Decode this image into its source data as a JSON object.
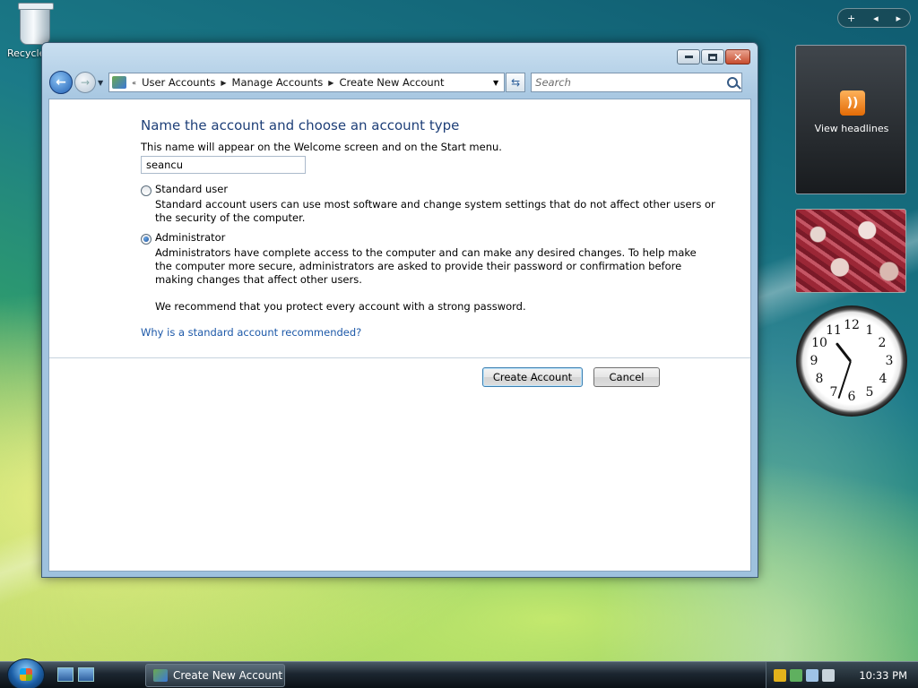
{
  "desktop": {
    "recycle_bin_label": "Recycle Bin"
  },
  "window": {
    "breadcrumb": [
      "User Accounts",
      "Manage Accounts",
      "Create New Account"
    ],
    "search_placeholder": "Search",
    "heading": "Name the account and choose an account type",
    "name_hint": "This name will appear on the Welcome screen and on the Start menu.",
    "account_name": "seancu",
    "options": [
      {
        "label": "Standard user",
        "desc1": "Standard account users can use most software and change system settings that do not affect other users or",
        "desc2": "the security of the computer.",
        "selected": false
      },
      {
        "label": "Administrator",
        "desc1": "Administrators have complete access to the computer and can make any desired changes. To help make",
        "desc2": "the computer more secure, administrators are asked to provide their password or confirmation before",
        "desc3": "making changes that affect other users.",
        "selected": true
      }
    ],
    "recommend": "We recommend that you protect every account with a strong password.",
    "link": "Why is a standard account recommended?",
    "create_button": "Create Account",
    "cancel_button": "Cancel"
  },
  "sidebar": {
    "feed_label": "View headlines",
    "clock_numbers": [
      "12",
      "1",
      "2",
      "3",
      "4",
      "5",
      "6",
      "7",
      "8",
      "9",
      "10",
      "11"
    ]
  },
  "taskbar": {
    "active_task": "Create New Account",
    "time": "10:33 PM"
  },
  "colors": {
    "heading": "#1e3f78",
    "link": "#1c58a8",
    "accent": "#3c7fb1"
  }
}
